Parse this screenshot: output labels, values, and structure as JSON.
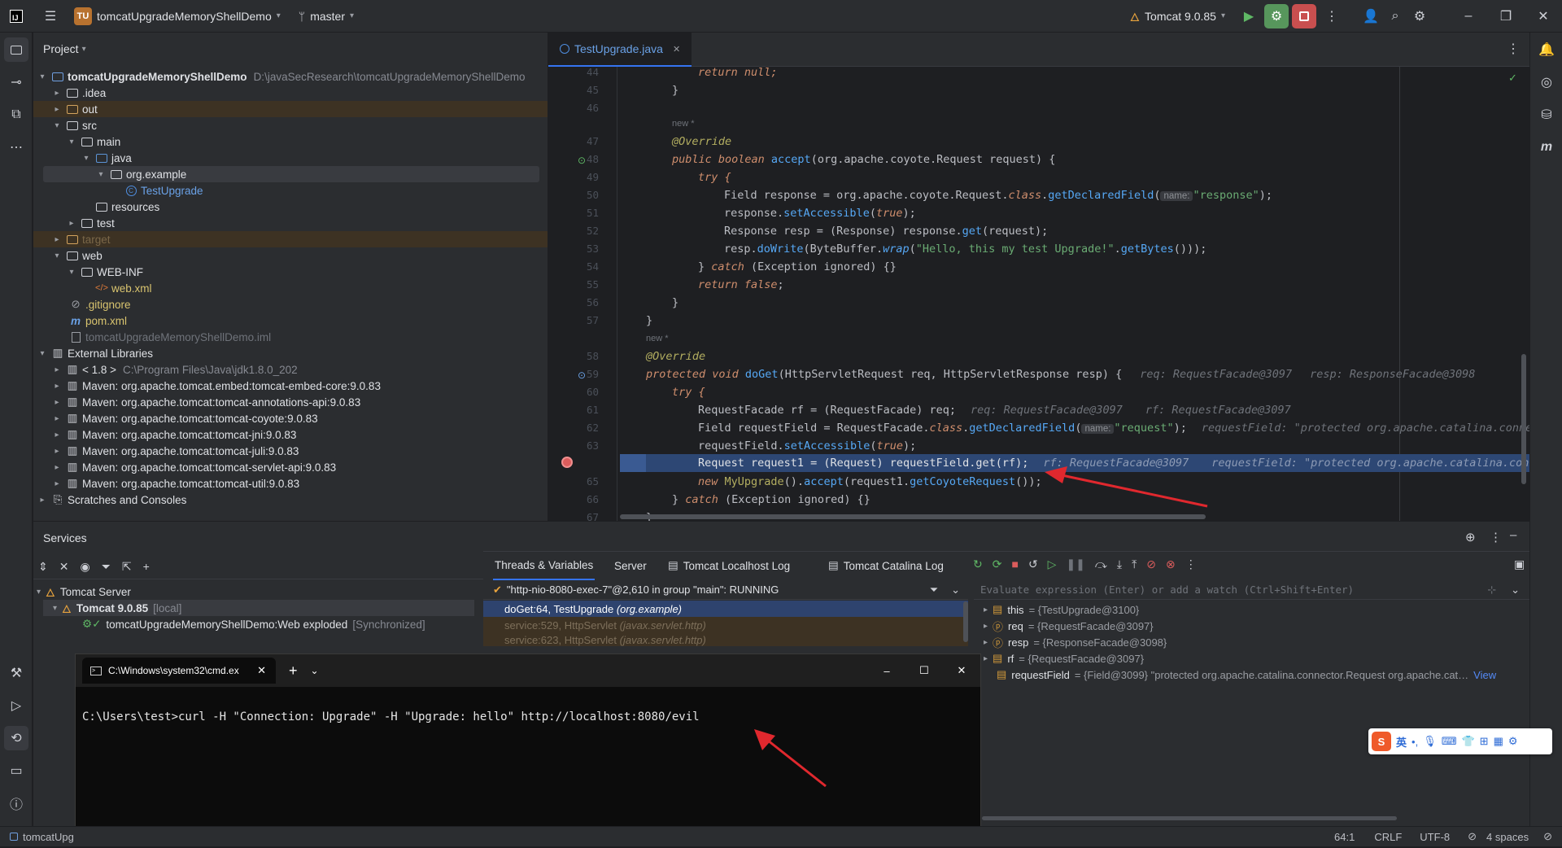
{
  "titlebar": {
    "project_badge": "TU",
    "project_name": "tomcatUpgradeMemoryShellDemo",
    "branch": "master",
    "run_config": "Tomcat 9.0.85"
  },
  "project_panel": {
    "title": "Project",
    "root": {
      "name": "tomcatUpgradeMemoryShellDemo",
      "path": "D:\\javaSecResearch\\tomcatUpgradeMemoryShellDemo"
    },
    "rows": [
      {
        "label": ".idea"
      },
      {
        "label": "out"
      },
      {
        "label": "src"
      },
      {
        "label": "main"
      },
      {
        "label": "java"
      },
      {
        "label": "org.example"
      },
      {
        "label": "TestUpgrade"
      },
      {
        "label": "resources"
      },
      {
        "label": "test"
      },
      {
        "label": "target"
      },
      {
        "label": "web"
      },
      {
        "label": "WEB-INF"
      },
      {
        "label": "web.xml"
      },
      {
        "label": ".gitignore"
      },
      {
        "label": "pom.xml"
      },
      {
        "label": "tomcatUpgradeMemoryShellDemo.iml"
      },
      {
        "label": "External Libraries"
      },
      {
        "label": "< 1.8 >",
        "extra": "C:\\Program Files\\Java\\jdk1.8.0_202"
      },
      {
        "label": "Maven: org.apache.tomcat.embed:tomcat-embed-core:9.0.83"
      },
      {
        "label": "Maven: org.apache.tomcat:tomcat-annotations-api:9.0.83"
      },
      {
        "label": "Maven: org.apache.tomcat:tomcat-coyote:9.0.83"
      },
      {
        "label": "Maven: org.apache.tomcat:tomcat-jni:9.0.83"
      },
      {
        "label": "Maven: org.apache.tomcat:tomcat-juli:9.0.83"
      },
      {
        "label": "Maven: org.apache.tomcat:tomcat-servlet-api:9.0.83"
      },
      {
        "label": "Maven: org.apache.tomcat:tomcat-util:9.0.83"
      },
      {
        "label": "Scratches and Consoles"
      }
    ]
  },
  "editor": {
    "tab": "TestUpgrade.java",
    "line_numbers": [
      "44",
      "45",
      "46",
      "47",
      "48",
      "49",
      "50",
      "51",
      "52",
      "53",
      "54",
      "55",
      "56",
      "57",
      "58",
      "59",
      "60",
      "61",
      "62",
      "63",
      "64",
      "65",
      "66",
      "67"
    ],
    "new_label": "new *",
    "hint_name": "name:",
    "code": {
      "l44": "return null;",
      "l47": "@Override",
      "l48a": "public boolean ",
      "l48b": "accept",
      "l48c": "(org.apache.coyote.Request request) {",
      "l49": "try {",
      "l50a": "Field response = org.apache.coyote.Request.",
      "l50b": "class",
      "l50c": ".",
      "l50d": "getDeclaredField",
      "l50e": "(",
      "l50f": "\"response\"",
      "l50g": ");",
      "l51a": "response.",
      "l51b": "setAccessible",
      "l51c": "(",
      "l51d": "true",
      "l51e": ");",
      "l52a": "Response resp = (Response) response.",
      "l52b": "get",
      "l52c": "(request);",
      "l53a": "resp.",
      "l53b": "doWrite",
      "l53c": "(ByteBuffer.",
      "l53d": "wrap",
      "l53e": "(",
      "l53f": "\"Hello, this my test Upgrade!\"",
      "l53g": ".",
      "l53h": "getBytes",
      "l53i": "()));",
      "l54a": "} ",
      "l54b": "catch",
      "l54c": " (Exception ignored) {}",
      "l55a": "return false",
      "l55b": ";",
      "l56": "}",
      "l57": "}",
      "l58": "@Override",
      "l59a": "protected void ",
      "l59b": "doGet",
      "l59c": "(HttpServletRequest req, HttpServletResponse resp) {",
      "l59h1": "req: RequestFacade@3097",
      "l59h2": "resp: ResponseFacade@3098",
      "l60": "try {",
      "l61a": "RequestFacade rf = (RequestFacade) req;",
      "l61h1": "req: RequestFacade@3097",
      "l61h2": "rf: RequestFacade@3097",
      "l62a": "Field requestField = RequestFacade.",
      "l62b": "class",
      "l62c": ".",
      "l62d": "getDeclaredField",
      "l62e": "(",
      "l62f": "\"request\"",
      "l62g": ");",
      "l62h": "requestField: \"protected org.apache.catalina.conne",
      "l63a": "requestField.",
      "l63b": "setAccessible",
      "l63c": "(",
      "l63d": "true",
      "l63e": ");",
      "l64a": "Request request1 = (Request) requestField.",
      "l64b": "get",
      "l64c": "(rf);",
      "l64h1": "rf: RequestFacade@3097",
      "l64h2": "requestField: \"protected org.apache.catalina.conn",
      "l65a": "new ",
      "l65b": "MyUpgrade",
      "l65c": "().",
      "l65d": "accept",
      "l65e": "(request1.",
      "l65f": "getCoyoteRequest",
      "l65g": "());",
      "l66a": "} ",
      "l66b": "catch",
      "l66c": " (Exception ignored) {}",
      "l67": "}"
    }
  },
  "services": {
    "title": "Services",
    "tree": {
      "server": "Tomcat Server",
      "instance": "Tomcat 9.0.85",
      "instance_tag": "[local]",
      "artifact": "tomcatUpgradeMemoryShellDemo:Web exploded",
      "artifact_tag": "[Synchronized]"
    },
    "tabs": [
      "Threads & Variables",
      "Server",
      "Tomcat Localhost Log",
      "Tomcat Catalina Log"
    ],
    "thread": "\"http-nio-8080-exec-7\"@2,610 in group \"main\": RUNNING",
    "frames": [
      {
        "method": "doGet:64, TestUpgrade",
        "pkg": "(org.example)"
      },
      {
        "method": "service:529, HttpServlet",
        "pkg": "(javax.servlet.http)"
      },
      {
        "method": "service:623, HttpServlet",
        "pkg": "(javax.servlet.http)"
      }
    ],
    "eval_placeholder": "Evaluate expression (Enter) or add a watch (Ctrl+Shift+Enter)",
    "variables": [
      {
        "name": "this",
        "value": "= {TestUpgrade@3100}"
      },
      {
        "name": "req",
        "value": "= {RequestFacade@3097}"
      },
      {
        "name": "resp",
        "value": "= {ResponseFacade@3098}"
      },
      {
        "name": "rf",
        "value": "= {RequestFacade@3097}"
      },
      {
        "name": "requestField",
        "value": "= {Field@3099} \"protected org.apache.catalina.connector.Request org.apache.cat…",
        "link": "View"
      }
    ]
  },
  "cmd": {
    "title": "C:\\Windows\\system32\\cmd.ex",
    "command": "C:\\Users\\test>curl -H \"Connection: Upgrade\" -H \"Upgrade: hello\" http://localhost:8080/evil"
  },
  "statusbar": {
    "left": "tomcatUpg",
    "position": "64:1",
    "line_sep": "CRLF",
    "encoding": "UTF-8",
    "indent": "4 spaces"
  },
  "ime": {
    "mode": "英"
  },
  "colors": {
    "accent": "#3574f0",
    "breakpoint": "#db5c5c",
    "annotation_arrow": "#e0282e"
  }
}
